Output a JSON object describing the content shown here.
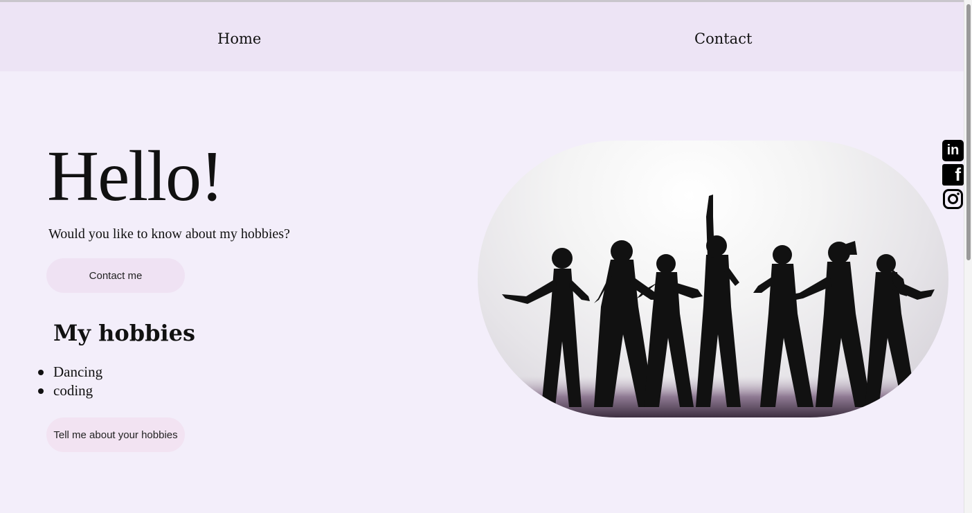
{
  "nav": {
    "home_label": "Home",
    "contact_label": "Contact"
  },
  "hero": {
    "title": "Hello!",
    "intro": "Would you like to know about my hobbies?",
    "contact_button": "Contact me"
  },
  "hobbies": {
    "title": "My hobbies",
    "items": [
      "Dancing",
      "coding"
    ],
    "button": "Tell me about your hobbies"
  },
  "image": {
    "description_icon": "dancers-photo"
  },
  "social": {
    "icons": [
      "linkedin-icon",
      "facebook-icon",
      "instagram-icon"
    ],
    "linkedin_text": "in",
    "facebook_text": "f"
  },
  "colors": {
    "background": "#f3eefa",
    "nav_background": "#ede4f5",
    "button_background": "#efe2f3"
  }
}
